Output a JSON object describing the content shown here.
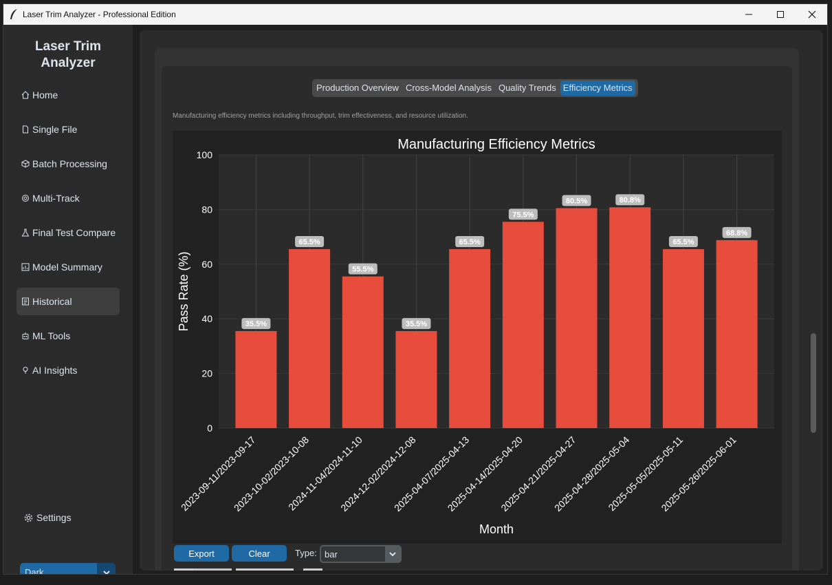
{
  "window": {
    "title": "Laser Trim Analyzer - Professional Edition"
  },
  "sidebar": {
    "logo_line1": "Laser Trim",
    "logo_line2": "Analyzer",
    "items": [
      {
        "label": "Home",
        "icon": "home-icon"
      },
      {
        "label": "Single File",
        "icon": "document-icon"
      },
      {
        "label": "Batch Processing",
        "icon": "package-icon"
      },
      {
        "label": "Multi-Track",
        "icon": "target-icon"
      },
      {
        "label": "Final Test Compare",
        "icon": "flask-icon"
      },
      {
        "label": "Model Summary",
        "icon": "chart-icon"
      },
      {
        "label": "Historical",
        "icon": "history-icon"
      },
      {
        "label": "ML Tools",
        "icon": "robot-icon"
      },
      {
        "label": "AI Insights",
        "icon": "lightbulb-icon"
      }
    ],
    "active_item": "Historical",
    "settings_label": "Settings",
    "theme": "Dark"
  },
  "tabs": [
    "Production Overview",
    "Cross-Model Analysis",
    "Quality Trends",
    "Efficiency Metrics"
  ],
  "active_tab": "Efficiency Metrics",
  "description": "Manufacturing efficiency metrics including throughput, trim effectiveness, and resource utilization.",
  "controls": {
    "export_label": "Export",
    "clear_label": "Clear",
    "type_label": "Type:",
    "type_value": "bar"
  },
  "colors": {
    "accent": "#1f6aa5",
    "bar": "#e84c3d",
    "chart_bg": "#222222"
  },
  "chart_data": {
    "type": "bar",
    "title": "Manufacturing Efficiency Metrics",
    "xlabel": "Month",
    "ylabel": "Pass Rate (%)",
    "ylim": [
      0,
      100
    ],
    "yticks": [
      0,
      20,
      40,
      60,
      80,
      100
    ],
    "grid": true,
    "categories": [
      "2023-09-11/2023-09-17",
      "2023-10-02/2023-10-08",
      "2024-11-04/2024-11-10",
      "2024-12-02/2024-12-08",
      "2025-04-07/2025-04-13",
      "2025-04-14/2025-04-20",
      "2025-04-21/2025-04-27",
      "2025-04-28/2025-05-04",
      "2025-05-05/2025-05-11",
      "2025-05-26/2025-06-01"
    ],
    "values": [
      35.5,
      65.5,
      55.5,
      35.5,
      65.5,
      75.5,
      80.5,
      80.8,
      65.5,
      68.8
    ],
    "data_labels": [
      "35.5%",
      "65.5%",
      "55.5%",
      "35.5%",
      "65.5%",
      "75.5%",
      "80.5%",
      "80.8%",
      "65.5%",
      "68.8%"
    ]
  }
}
